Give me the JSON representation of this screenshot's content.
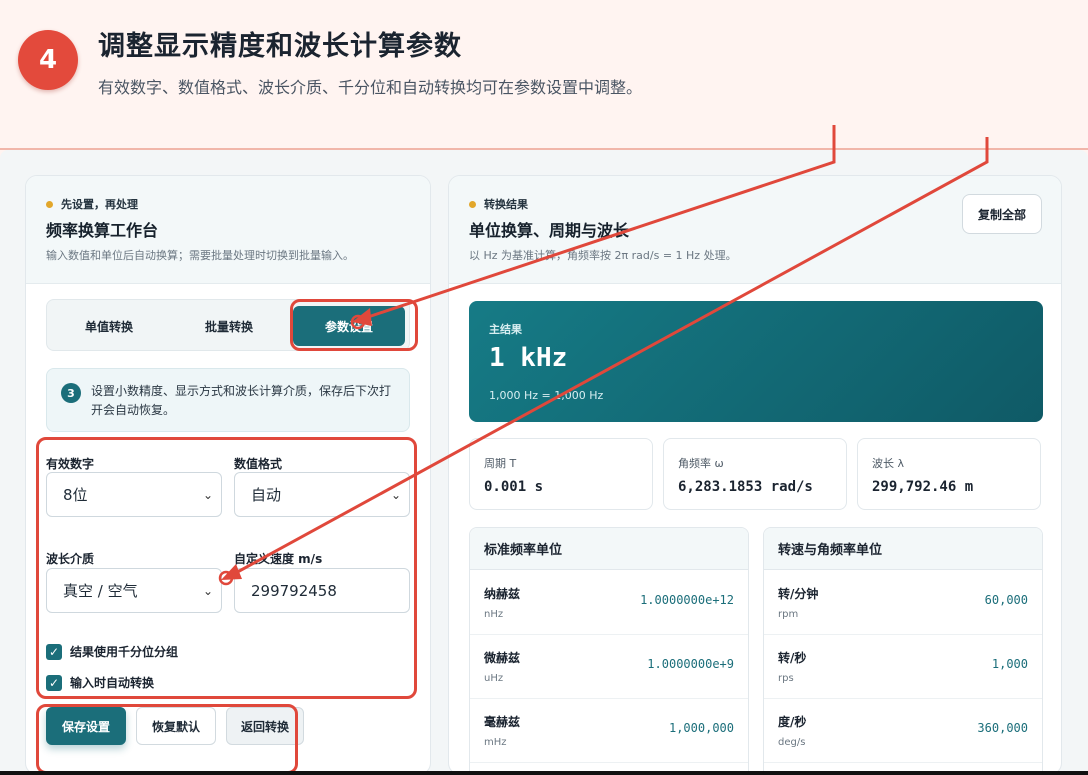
{
  "banner": {
    "step": "4",
    "title": "调整显示精度和波长计算参数",
    "subtitle": "有效数字、数值格式、波长介质、千分位和自动转换均可在参数设置中调整。"
  },
  "left": {
    "eyebrow": "先设置，再处理",
    "title": "频率换算工作台",
    "desc": "输入数值和单位后自动换算；需要批量处理时切换到批量输入。",
    "tabs": [
      "单值转换",
      "批量转换",
      "参数设置"
    ],
    "info_num": "3",
    "info_text": "设置小数精度、显示方式和波长计算介质，保存后下次打开会自动恢复。",
    "sig_label": "有效数字",
    "sig_value": "8位",
    "fmt_label": "数值格式",
    "fmt_value": "自动",
    "medium_label": "波长介质",
    "medium_value": "真空 / 空气",
    "speed_label": "自定义速度 m/s",
    "speed_value": "299792458",
    "check1": "结果使用千分位分组",
    "check2": "输入时自动转换",
    "btn_save": "保存设置",
    "btn_reset": "恢复默认",
    "btn_back": "返回转换"
  },
  "right": {
    "eyebrow": "转换结果",
    "title": "单位换算、周期与波长",
    "desc": "以 Hz 为基准计算，角频率按 2π rad/s = 1 Hz 处理。",
    "copy": "复制全部",
    "result_label": "主结果",
    "result_value": "1 kHz",
    "result_foot": "1,000 Hz = 1,000 Hz",
    "stats": [
      {
        "label": "周期 T",
        "value": "0.001 s"
      },
      {
        "label": "角频率 ω",
        "value": "6,283.1853 rad/s"
      },
      {
        "label": "波长 λ",
        "value": "299,792.46 m"
      }
    ],
    "table1": {
      "title": "标准频率单位",
      "rows": [
        {
          "name": "纳赫兹",
          "sym": "nHz",
          "val": "1.0000000e+12"
        },
        {
          "name": "微赫兹",
          "sym": "uHz",
          "val": "1.0000000e+9"
        },
        {
          "name": "毫赫兹",
          "sym": "mHz",
          "val": "1,000,000"
        }
      ]
    },
    "table2": {
      "title": "转速与角频率单位",
      "rows": [
        {
          "name": "转/分钟",
          "sym": "rpm",
          "val": "60,000"
        },
        {
          "name": "转/秒",
          "sym": "rps",
          "val": "1,000"
        },
        {
          "name": "度/秒",
          "sym": "deg/s",
          "val": "360,000"
        }
      ]
    }
  }
}
